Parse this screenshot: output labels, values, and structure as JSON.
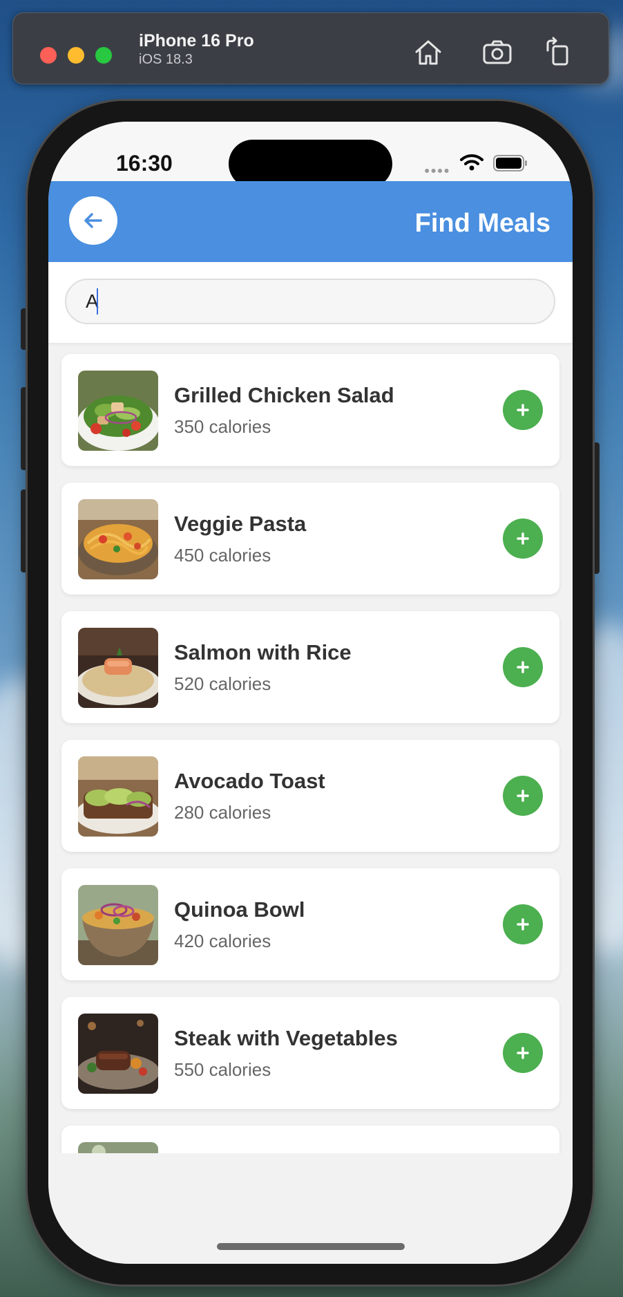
{
  "simulator": {
    "device_name": "iPhone 16 Pro",
    "os_version": "iOS 18.3",
    "icons": [
      "home-icon",
      "screenshot-icon",
      "rotate-icon"
    ]
  },
  "status_bar": {
    "time": "16:30"
  },
  "header": {
    "title": "Find Meals",
    "back_icon": "arrow-left-icon",
    "color": "#4a8fe0"
  },
  "search": {
    "value": "A"
  },
  "meals": [
    {
      "name": "Grilled Chicken Salad",
      "calories": "350 calories",
      "image": "salad-photo"
    },
    {
      "name": "Veggie Pasta",
      "calories": "450 calories",
      "image": "pasta-photo"
    },
    {
      "name": "Salmon with Rice",
      "calories": "520 calories",
      "image": "salmon-photo"
    },
    {
      "name": "Avocado Toast",
      "calories": "280 calories",
      "image": "toast-photo"
    },
    {
      "name": "Quinoa Bowl",
      "calories": "420 calories",
      "image": "bowl-photo"
    },
    {
      "name": "Steak with Vegetables",
      "calories": "550 calories",
      "image": "steak-photo"
    }
  ],
  "add_button": {
    "icon": "plus-icon",
    "color": "#4caf50"
  }
}
